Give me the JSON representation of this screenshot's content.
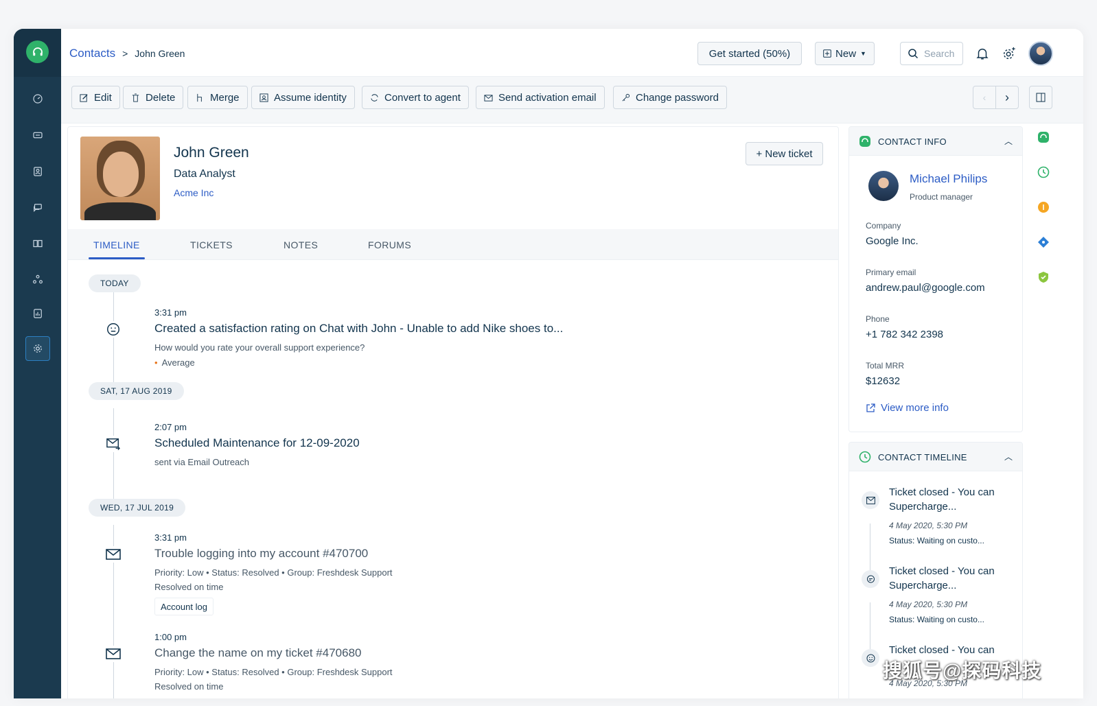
{
  "header": {
    "breadcrumb_root": "Contacts",
    "breadcrumb_sep": ">",
    "breadcrumb_current": "John Green",
    "get_started_label": "Get started (50%)",
    "new_label": "New",
    "search_placeholder": "Search"
  },
  "toolbar": {
    "edit": "Edit",
    "delete": "Delete",
    "merge": "Merge",
    "assume_identity": "Assume identity",
    "convert_to_agent": "Convert to agent",
    "send_activation_email": "Send activation email",
    "change_password": "Change password"
  },
  "contact": {
    "name": "John Green",
    "title": "Data Analyst",
    "company": "Acme Inc",
    "new_ticket_label": "+ New ticket"
  },
  "tabs": [
    "TIMELINE",
    "TICKETS",
    "NOTES",
    "FORUMS"
  ],
  "timeline": {
    "groups": [
      {
        "date": "TODAY",
        "events": [
          {
            "time": "3:31 pm",
            "title": "Created a satisfaction rating on Chat with John - Unable to add Nike shoes to...",
            "sub1": "How would you rate your overall support experience?",
            "sub2": "Average"
          }
        ]
      },
      {
        "date": "SAT, 17 AUG 2019",
        "events": [
          {
            "time": "2:07 pm",
            "title": "Scheduled Maintenance for 12-09-2020",
            "sub1": "sent via Email Outreach"
          }
        ]
      },
      {
        "date": "WED, 17 JUL 2019",
        "events": [
          {
            "time": "3:31 pm",
            "title": "Trouble logging into my account #470700",
            "sub1": "Priority: Low  •  Status: Resolved  •  Group: Freshdesk Support",
            "sub2": "Resolved on time",
            "button": "Account log"
          },
          {
            "time": "1:00 pm",
            "title": "Change the name on my ticket #470680",
            "sub1": "Priority: Low  •  Status: Resolved  •  Group: Freshdesk Support",
            "sub2": "Resolved on time"
          }
        ]
      }
    ]
  },
  "contact_info": {
    "heading": "CONTACT INFO",
    "agent_name": "Michael Philips",
    "agent_role": "Product manager",
    "company_label": "Company",
    "company_value": "Google Inc.",
    "email_label": "Primary email",
    "email_value": "andrew.paul@google.com",
    "phone_label": "Phone",
    "phone_value": "+1 782 342 2398",
    "mrr_label": "Total MRR",
    "mrr_value": "$12632",
    "view_more": "View more info"
  },
  "contact_timeline": {
    "heading": "CONTACT TIMELINE",
    "items": [
      {
        "title": "Ticket closed - You can Supercharge...",
        "date": "4 May 2020, 5:30 PM",
        "status": "Status: Waiting on custo..."
      },
      {
        "title": "Ticket closed - You can Supercharge...",
        "date": "4 May 2020, 5:30 PM",
        "status": "Status: Waiting on custo..."
      },
      {
        "title": "Ticket closed - You can",
        "date": "4 May 2020, 5:30 PM",
        "status": ""
      }
    ]
  },
  "watermark": "搜狐号@探码科技",
  "colors": {
    "sidebar": "#1b3a4f",
    "accent": "#2c5cc5",
    "brand": "#2fb26a"
  }
}
